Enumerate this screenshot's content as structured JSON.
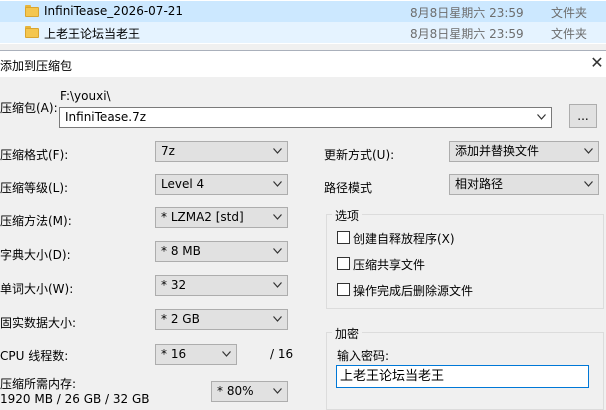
{
  "files": [
    {
      "name": "InfiniTease_2026-07-21",
      "date": "8月8日星期六 23:59",
      "type": "文件夹",
      "icon": "folder-icon"
    },
    {
      "name": "上老王论坛当老王",
      "date": "8月8日星期六 23:59",
      "type": "文件夹",
      "icon": "folder-icon"
    }
  ],
  "dialog": {
    "title": "添加到压缩包",
    "close": "✕",
    "archive": {
      "label": "压缩包(A):",
      "path": "F:\\youxi\\",
      "value": "InfiniTease.7z",
      "browse": "..."
    },
    "format": {
      "label": "压缩格式(F):",
      "value": "7z"
    },
    "level": {
      "label": "压缩等级(L):",
      "value": "Level 4"
    },
    "method": {
      "label": "压缩方法(M):",
      "value": "* LZMA2 [std]"
    },
    "dict": {
      "label": "字典大小(D):",
      "value": "* 8 MB"
    },
    "word": {
      "label": "单词大小(W):",
      "value": "* 32"
    },
    "solid": {
      "label": "固实数据大小:",
      "value": "* 2 GB"
    },
    "threads": {
      "label": "CPU 线程数:",
      "value": "* 16",
      "max": "/ 16"
    },
    "memory": {
      "label": "压缩所需内存:",
      "detail": "1920 MB / 26 GB / 32 GB",
      "value": "* 80%"
    },
    "update": {
      "label": "更新方式(U):",
      "value": "添加并替换文件"
    },
    "pathmode": {
      "label": "路径模式",
      "value": "相对路径"
    },
    "options": {
      "title": "选项",
      "items": [
        "创建自释放程序(X)",
        "压缩共享文件",
        "操作完成后删除源文件"
      ]
    },
    "encryption": {
      "title": "加密",
      "prompt": "输入密码:",
      "password": "上老王论坛当老王"
    }
  },
  "colors": {
    "selection": "#cce8ff",
    "focus": "#0078d7",
    "folder": "#f4c64f"
  }
}
